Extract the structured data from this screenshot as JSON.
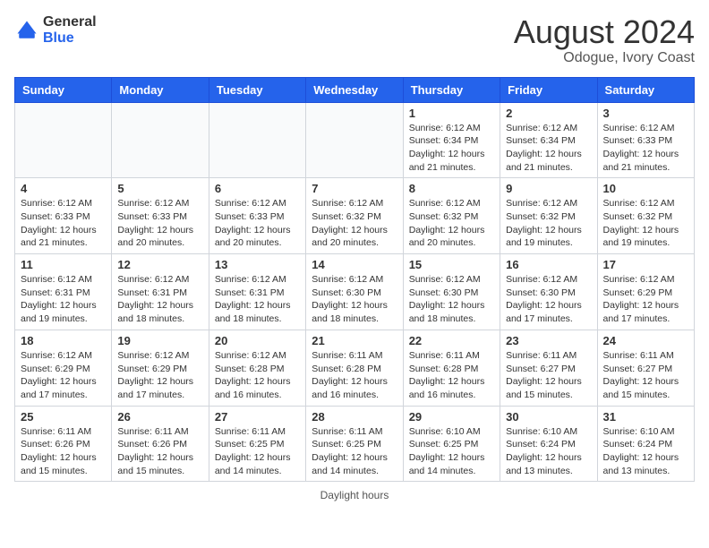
{
  "header": {
    "logo_general": "General",
    "logo_blue": "Blue",
    "month_year": "August 2024",
    "location": "Odogue, Ivory Coast"
  },
  "days_of_week": [
    "Sunday",
    "Monday",
    "Tuesday",
    "Wednesday",
    "Thursday",
    "Friday",
    "Saturday"
  ],
  "weeks": [
    [
      {
        "day": "",
        "info": ""
      },
      {
        "day": "",
        "info": ""
      },
      {
        "day": "",
        "info": ""
      },
      {
        "day": "",
        "info": ""
      },
      {
        "day": "1",
        "info": "Sunrise: 6:12 AM\nSunset: 6:34 PM\nDaylight: 12 hours\nand 21 minutes."
      },
      {
        "day": "2",
        "info": "Sunrise: 6:12 AM\nSunset: 6:34 PM\nDaylight: 12 hours\nand 21 minutes."
      },
      {
        "day": "3",
        "info": "Sunrise: 6:12 AM\nSunset: 6:33 PM\nDaylight: 12 hours\nand 21 minutes."
      }
    ],
    [
      {
        "day": "4",
        "info": "Sunrise: 6:12 AM\nSunset: 6:33 PM\nDaylight: 12 hours\nand 21 minutes."
      },
      {
        "day": "5",
        "info": "Sunrise: 6:12 AM\nSunset: 6:33 PM\nDaylight: 12 hours\nand 20 minutes."
      },
      {
        "day": "6",
        "info": "Sunrise: 6:12 AM\nSunset: 6:33 PM\nDaylight: 12 hours\nand 20 minutes."
      },
      {
        "day": "7",
        "info": "Sunrise: 6:12 AM\nSunset: 6:32 PM\nDaylight: 12 hours\nand 20 minutes."
      },
      {
        "day": "8",
        "info": "Sunrise: 6:12 AM\nSunset: 6:32 PM\nDaylight: 12 hours\nand 20 minutes."
      },
      {
        "day": "9",
        "info": "Sunrise: 6:12 AM\nSunset: 6:32 PM\nDaylight: 12 hours\nand 19 minutes."
      },
      {
        "day": "10",
        "info": "Sunrise: 6:12 AM\nSunset: 6:32 PM\nDaylight: 12 hours\nand 19 minutes."
      }
    ],
    [
      {
        "day": "11",
        "info": "Sunrise: 6:12 AM\nSunset: 6:31 PM\nDaylight: 12 hours\nand 19 minutes."
      },
      {
        "day": "12",
        "info": "Sunrise: 6:12 AM\nSunset: 6:31 PM\nDaylight: 12 hours\nand 18 minutes."
      },
      {
        "day": "13",
        "info": "Sunrise: 6:12 AM\nSunset: 6:31 PM\nDaylight: 12 hours\nand 18 minutes."
      },
      {
        "day": "14",
        "info": "Sunrise: 6:12 AM\nSunset: 6:30 PM\nDaylight: 12 hours\nand 18 minutes."
      },
      {
        "day": "15",
        "info": "Sunrise: 6:12 AM\nSunset: 6:30 PM\nDaylight: 12 hours\nand 18 minutes."
      },
      {
        "day": "16",
        "info": "Sunrise: 6:12 AM\nSunset: 6:30 PM\nDaylight: 12 hours\nand 17 minutes."
      },
      {
        "day": "17",
        "info": "Sunrise: 6:12 AM\nSunset: 6:29 PM\nDaylight: 12 hours\nand 17 minutes."
      }
    ],
    [
      {
        "day": "18",
        "info": "Sunrise: 6:12 AM\nSunset: 6:29 PM\nDaylight: 12 hours\nand 17 minutes."
      },
      {
        "day": "19",
        "info": "Sunrise: 6:12 AM\nSunset: 6:29 PM\nDaylight: 12 hours\nand 17 minutes."
      },
      {
        "day": "20",
        "info": "Sunrise: 6:12 AM\nSunset: 6:28 PM\nDaylight: 12 hours\nand 16 minutes."
      },
      {
        "day": "21",
        "info": "Sunrise: 6:11 AM\nSunset: 6:28 PM\nDaylight: 12 hours\nand 16 minutes."
      },
      {
        "day": "22",
        "info": "Sunrise: 6:11 AM\nSunset: 6:28 PM\nDaylight: 12 hours\nand 16 minutes."
      },
      {
        "day": "23",
        "info": "Sunrise: 6:11 AM\nSunset: 6:27 PM\nDaylight: 12 hours\nand 15 minutes."
      },
      {
        "day": "24",
        "info": "Sunrise: 6:11 AM\nSunset: 6:27 PM\nDaylight: 12 hours\nand 15 minutes."
      }
    ],
    [
      {
        "day": "25",
        "info": "Sunrise: 6:11 AM\nSunset: 6:26 PM\nDaylight: 12 hours\nand 15 minutes."
      },
      {
        "day": "26",
        "info": "Sunrise: 6:11 AM\nSunset: 6:26 PM\nDaylight: 12 hours\nand 15 minutes."
      },
      {
        "day": "27",
        "info": "Sunrise: 6:11 AM\nSunset: 6:25 PM\nDaylight: 12 hours\nand 14 minutes."
      },
      {
        "day": "28",
        "info": "Sunrise: 6:11 AM\nSunset: 6:25 PM\nDaylight: 12 hours\nand 14 minutes."
      },
      {
        "day": "29",
        "info": "Sunrise: 6:10 AM\nSunset: 6:25 PM\nDaylight: 12 hours\nand 14 minutes."
      },
      {
        "day": "30",
        "info": "Sunrise: 6:10 AM\nSunset: 6:24 PM\nDaylight: 12 hours\nand 13 minutes."
      },
      {
        "day": "31",
        "info": "Sunrise: 6:10 AM\nSunset: 6:24 PM\nDaylight: 12 hours\nand 13 minutes."
      }
    ]
  ],
  "footer": {
    "text": "Daylight hours",
    "url": "https://www.generalblue.com"
  }
}
